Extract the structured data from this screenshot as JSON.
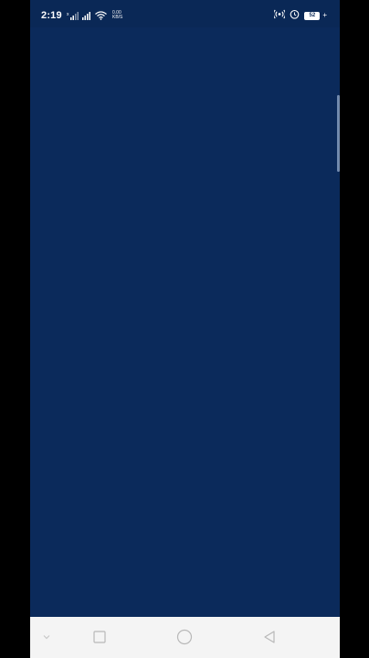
{
  "status_bar": {
    "time": "2:19",
    "net_speed_value": "0.00",
    "net_speed_unit": "KB/S",
    "battery_level": "52"
  },
  "colors": {
    "screen_background": "#0b2a5b",
    "status_bar_background": "#0a2856",
    "nav_bar_background": "#f4f4f4",
    "frame_background": "#000000"
  },
  "icons": {
    "signal_left": "signal-1-icon",
    "signal_right": "signal-2-icon",
    "wifi": "wifi-icon",
    "hotspot": "hotspot-icon",
    "alarm": "alarm-icon",
    "battery": "battery-icon",
    "charging": "charging-bolt-icon",
    "nav_hide": "chevron-down-icon",
    "nav_recents": "recents-square-icon",
    "nav_home": "home-circle-icon",
    "nav_back": "back-triangle-icon"
  }
}
